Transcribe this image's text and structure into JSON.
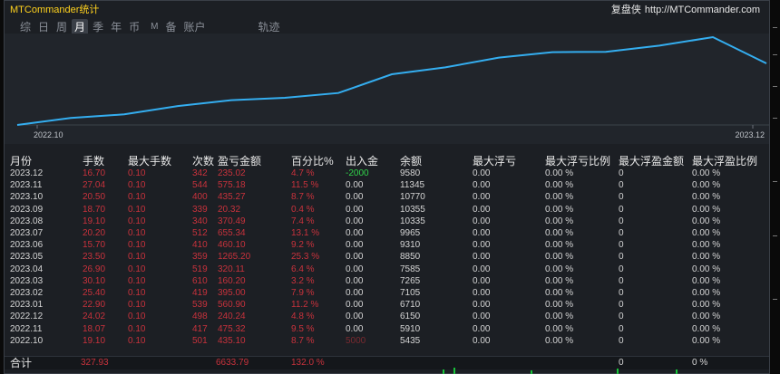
{
  "app": {
    "title": "MTCommander统计",
    "brand": "复盘侠",
    "site": "http://MTCommander.com"
  },
  "tabs": [
    {
      "label": "综",
      "active": false,
      "small": false
    },
    {
      "label": "日",
      "active": false,
      "small": false
    },
    {
      "label": "周",
      "active": false,
      "small": false
    },
    {
      "label": "月",
      "active": true,
      "small": false
    },
    {
      "label": "季",
      "active": false,
      "small": false
    },
    {
      "label": "年",
      "active": false,
      "small": false
    },
    {
      "label": "币",
      "active": false,
      "small": false
    },
    {
      "label": "M",
      "active": false,
      "small": true
    },
    {
      "label": "备",
      "active": false,
      "small": false
    },
    {
      "label": "账户",
      "active": false,
      "small": false
    },
    {
      "label": "轨迹",
      "active": false,
      "small": false
    }
  ],
  "colors": {
    "accent_line": "#34aef0",
    "loss": "#c8323c",
    "gain": "#30d24a",
    "title": "#ffd21e"
  },
  "chart_data": {
    "type": "line",
    "x_tick_labels": [
      "2022.10",
      "2023.12"
    ],
    "series": [
      {
        "name": "",
        "color": "#34aef0",
        "values": [
          5435,
          5910,
          6150,
          6710,
          7105,
          7265,
          7585,
          8850,
          9310,
          9965,
          10335,
          10355,
          10770,
          11345,
          9580
        ]
      }
    ]
  },
  "table": {
    "headers": [
      "月份",
      "手数",
      "最大手数",
      "次数",
      "盈亏金额",
      "百分比%",
      "出入金",
      "余额",
      "最大浮亏",
      "最大浮亏比例",
      "最大浮盈金额",
      "最大浮盈比例"
    ],
    "rows": [
      [
        "2023.12",
        "16.70",
        "0.10",
        "342",
        "235.02",
        "4.7 %",
        "-2000",
        "9580",
        "0.00",
        "0.00 %",
        "0",
        "0.00 %"
      ],
      [
        "2023.11",
        "27.04",
        "0.10",
        "544",
        "575.18",
        "11.5 %",
        "0.00",
        "11345",
        "0.00",
        "0.00 %",
        "0",
        "0.00 %"
      ],
      [
        "2023.10",
        "20.50",
        "0.10",
        "400",
        "435.27",
        "8.7 %",
        "0.00",
        "10770",
        "0.00",
        "0.00 %",
        "0",
        "0.00 %"
      ],
      [
        "2023.09",
        "18.70",
        "0.10",
        "339",
        "20.32",
        "0.4 %",
        "0.00",
        "10355",
        "0.00",
        "0.00 %",
        "0",
        "0.00 %"
      ],
      [
        "2023.08",
        "19.10",
        "0.10",
        "340",
        "370.49",
        "7.4 %",
        "0.00",
        "10335",
        "0.00",
        "0.00 %",
        "0",
        "0.00 %"
      ],
      [
        "2023.07",
        "20.20",
        "0.10",
        "512",
        "655.34",
        "13.1 %",
        "0.00",
        "9965",
        "0.00",
        "0.00 %",
        "0",
        "0.00 %"
      ],
      [
        "2023.06",
        "15.70",
        "0.10",
        "410",
        "460.10",
        "9.2 %",
        "0.00",
        "9310",
        "0.00",
        "0.00 %",
        "0",
        "0.00 %"
      ],
      [
        "2023.05",
        "23.50",
        "0.10",
        "359",
        "1265.20",
        "25.3 %",
        "0.00",
        "8850",
        "0.00",
        "0.00 %",
        "0",
        "0.00 %"
      ],
      [
        "2023.04",
        "26.90",
        "0.10",
        "519",
        "320.11",
        "6.4 %",
        "0.00",
        "7585",
        "0.00",
        "0.00 %",
        "0",
        "0.00 %"
      ],
      [
        "2023.03",
        "30.10",
        "0.10",
        "610",
        "160.20",
        "3.2 %",
        "0.00",
        "7265",
        "0.00",
        "0.00 %",
        "0",
        "0.00 %"
      ],
      [
        "2023.02",
        "25.40",
        "0.10",
        "419",
        "395.00",
        "7.9 %",
        "0.00",
        "7105",
        "0.00",
        "0.00 %",
        "0",
        "0.00 %"
      ],
      [
        "2023.01",
        "22.90",
        "0.10",
        "539",
        "560.90",
        "11.2 %",
        "0.00",
        "6710",
        "0.00",
        "0.00 %",
        "0",
        "0.00 %"
      ],
      [
        "2022.12",
        "24.02",
        "0.10",
        "498",
        "240.24",
        "4.8 %",
        "0.00",
        "6150",
        "0.00",
        "0.00 %",
        "0",
        "0.00 %"
      ],
      [
        "2022.11",
        "18.07",
        "0.10",
        "417",
        "475.32",
        "9.5 %",
        "0.00",
        "5910",
        "0.00",
        "0.00 %",
        "0",
        "0.00 %"
      ],
      [
        "2022.10",
        "19.10",
        "0.10",
        "501",
        "435.10",
        "8.7 %",
        "5000",
        "5435",
        "0.00",
        "0.00 %",
        "0",
        "0.00 %"
      ]
    ],
    "summary": {
      "label": "合计",
      "lots": "327.93",
      "pnl": "6633.79",
      "pct": "132.0 %",
      "max_float_profit": "0",
      "max_float_profit_pct": "0 %"
    }
  }
}
